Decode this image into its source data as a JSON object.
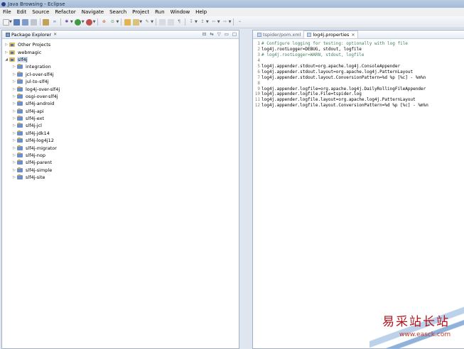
{
  "window": {
    "title": "Java Browsing - Eclipse"
  },
  "menu": [
    "File",
    "Edit",
    "Source",
    "Refactor",
    "Navigate",
    "Search",
    "Project",
    "Run",
    "Window",
    "Help"
  ],
  "package_explorer": {
    "tab_label": "Package Explorer",
    "tree": [
      {
        "label": "Other Projects",
        "type": "working-set",
        "expanded": false,
        "level": 0
      },
      {
        "label": "webmagic",
        "type": "working-set",
        "expanded": false,
        "level": 0
      },
      {
        "label": "slf4j",
        "type": "working-set",
        "expanded": true,
        "level": 0,
        "selected": true
      },
      {
        "label": "integration",
        "type": "project",
        "level": 1
      },
      {
        "label": "jcl-over-slf4j",
        "type": "project",
        "level": 1
      },
      {
        "label": "jul-to-slf4j",
        "type": "project",
        "level": 1
      },
      {
        "label": "log4j-over-slf4j",
        "type": "project",
        "level": 1
      },
      {
        "label": "osgi-over-slf4j",
        "type": "project",
        "level": 1
      },
      {
        "label": "slf4j-android",
        "type": "project",
        "level": 1
      },
      {
        "label": "slf4j-api",
        "type": "project",
        "level": 1
      },
      {
        "label": "slf4j-ext",
        "type": "project",
        "level": 1
      },
      {
        "label": "slf4j-jcl",
        "type": "project",
        "level": 1
      },
      {
        "label": "slf4j-jdk14",
        "type": "project",
        "level": 1
      },
      {
        "label": "slf4j-log4j12",
        "type": "project",
        "level": 1
      },
      {
        "label": "slf4j-migrator",
        "type": "project",
        "level": 1
      },
      {
        "label": "slf4j-nop",
        "type": "project",
        "level": 1
      },
      {
        "label": "slf4j-parent",
        "type": "project",
        "level": 1
      },
      {
        "label": "slf4j-simple",
        "type": "project",
        "level": 1
      },
      {
        "label": "slf4j-site",
        "type": "project",
        "level": 1
      }
    ]
  },
  "editor": {
    "tabs": [
      {
        "label": "tspider/pom.xml",
        "active": false
      },
      {
        "label": "log4j.properties",
        "active": true
      }
    ],
    "lines": [
      {
        "n": "1",
        "text": "# Configure logging for testing: optionally with log file",
        "style": "comment"
      },
      {
        "n": "2",
        "text": "log4j.rootLogger=DEBUG, stdout, logfile",
        "style": "plain"
      },
      {
        "n": "3",
        "text": "# log4j.rootLogger=WARN, stdout, logfile",
        "style": "comment"
      },
      {
        "n": "4",
        "text": "",
        "style": "plain"
      },
      {
        "n": "5",
        "text": "log4j.appender.stdout=org.apache.log4j.ConsoleAppender",
        "style": "plain"
      },
      {
        "n": "6",
        "text": "log4j.appender.stdout.layout=org.apache.log4j.PatternLayout",
        "style": "plain"
      },
      {
        "n": "7",
        "text": "log4j.appender.stdout.layout.ConversionPattern=%d %p [%c] - %m%n",
        "style": "plain"
      },
      {
        "n": "8",
        "text": "",
        "style": "plain"
      },
      {
        "n": "9",
        "text": "log4j.appender.logfile=org.apache.log4j.DailyRollingFileAppender",
        "style": "plain"
      },
      {
        "n": "10",
        "text": "log4j.appender.logfile.File=tspider.log",
        "style": "plain"
      },
      {
        "n": "11",
        "text": "log4j.appender.logfile.layout=org.apache.log4j.PatternLayout",
        "style": "plain"
      },
      {
        "n": "12",
        "text": "log4j.appender.logfile.layout.ConversionPattern=%d %p [%c] - %m%n",
        "style": "plain"
      }
    ]
  },
  "watermark": {
    "text_cn": "易采站长站",
    "url": "www.easck.com"
  }
}
